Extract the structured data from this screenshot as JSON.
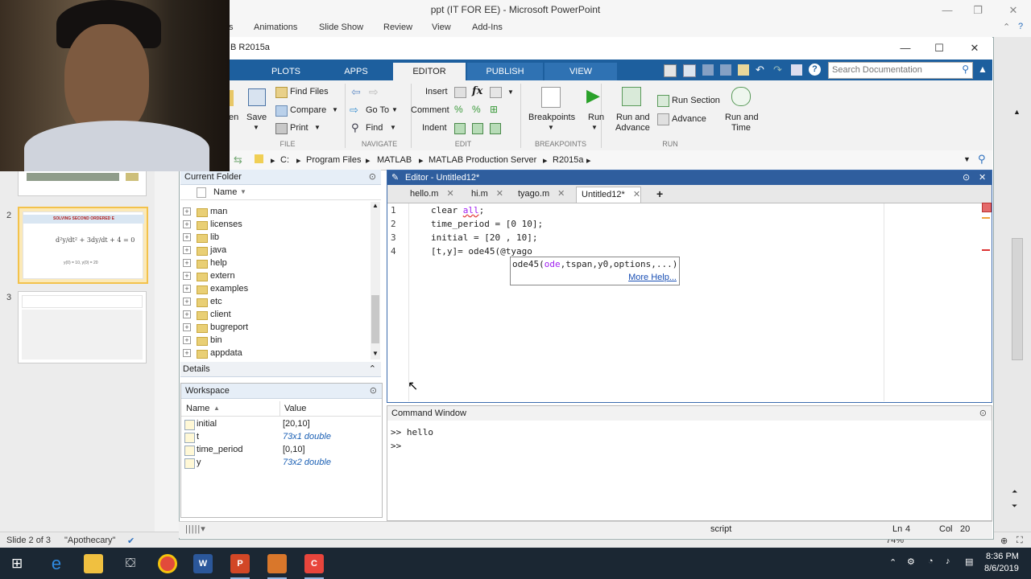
{
  "ppt": {
    "title": "ppt (IT FOR EE)  -  Microsoft PowerPoint",
    "menu": [
      "Animations",
      "Slide Show",
      "Review",
      "View",
      "Add-Ins"
    ],
    "partial_menu": "s",
    "slides": [
      {
        "number": "2",
        "heading": "SOLVING SECOND ORDERED E"
      },
      {
        "number": "3"
      }
    ],
    "status": {
      "slide": "Slide 2 of 3",
      "theme": "\"Apothecary\"",
      "zoom": "74%"
    }
  },
  "matlab": {
    "title": "B R2015a",
    "tabs": [
      "PLOTS",
      "APPS",
      "EDITOR",
      "PUBLISH",
      "VIEW"
    ],
    "active_tab": "EDITOR",
    "search_placeholder": "Search Documentation",
    "ribbon": {
      "file": {
        "partial": "en",
        "save": "Save",
        "find_files": "Find Files",
        "compare": "Compare",
        "print": "Print",
        "section": "FILE"
      },
      "navigate": {
        "go_to": "Go To",
        "find": "Find",
        "section": "NAVIGATE"
      },
      "edit": {
        "insert": "Insert",
        "comment": "Comment",
        "indent": "Indent",
        "fx": "fx",
        "section": "EDIT"
      },
      "breakpoints": {
        "label": "Breakpoints",
        "section": "BREAKPOINTS"
      },
      "run": {
        "run": "Run",
        "run_advance_1": "Run and",
        "run_advance_2": "Advance",
        "run_section": "Run Section",
        "advance": "Advance",
        "run_time_1": "Run and",
        "run_time_2": "Time",
        "section": "RUN"
      }
    },
    "address": [
      "C:",
      "Program Files",
      "MATLAB",
      "MATLAB Production Server",
      "R2015a"
    ],
    "current_folder": {
      "title": "Current Folder",
      "column": "Name",
      "items": [
        "man",
        "licenses",
        "lib",
        "java",
        "help",
        "extern",
        "examples",
        "etc",
        "client",
        "bugreport",
        "bin",
        "appdata"
      ]
    },
    "details_title": "Details",
    "workspace": {
      "title": "Workspace",
      "columns": [
        "Name",
        "Value"
      ],
      "rows": [
        {
          "name": "initial",
          "value": "[20,10]"
        },
        {
          "name": "t",
          "value": "73x1 double"
        },
        {
          "name": "time_period",
          "value": "[0,10]"
        },
        {
          "name": "y",
          "value": "73x2 double"
        }
      ]
    },
    "editor": {
      "title": "Editor - Untitled12*",
      "tabs": [
        "hello.m",
        "hi.m",
        "tyago.m",
        "Untitled12*"
      ],
      "lines": [
        {
          "n": "1",
          "pre": "clear ",
          "kw": "all",
          "post": ";"
        },
        {
          "n": "2",
          "text": "time_period = [0 10];"
        },
        {
          "n": "3",
          "text": "initial = [20 , 10];"
        },
        {
          "n": "4",
          "text": "[t,y]= ode45(@tyago"
        }
      ],
      "tooltip": {
        "signature_fn": "ode45(",
        "signature_arg": "ode",
        "signature_rest": ",tspan,y0,options,...)",
        "more_help": "More Help..."
      }
    },
    "command_window": {
      "title": "Command Window",
      "lines": [
        ">> hello",
        ">>"
      ]
    },
    "status": {
      "mode": "script",
      "ln_label": "Ln",
      "ln": "4",
      "col_label": "Col",
      "col": "20"
    }
  },
  "taskbar": {
    "time": "8:36 PM",
    "date": "8/6/2019"
  }
}
